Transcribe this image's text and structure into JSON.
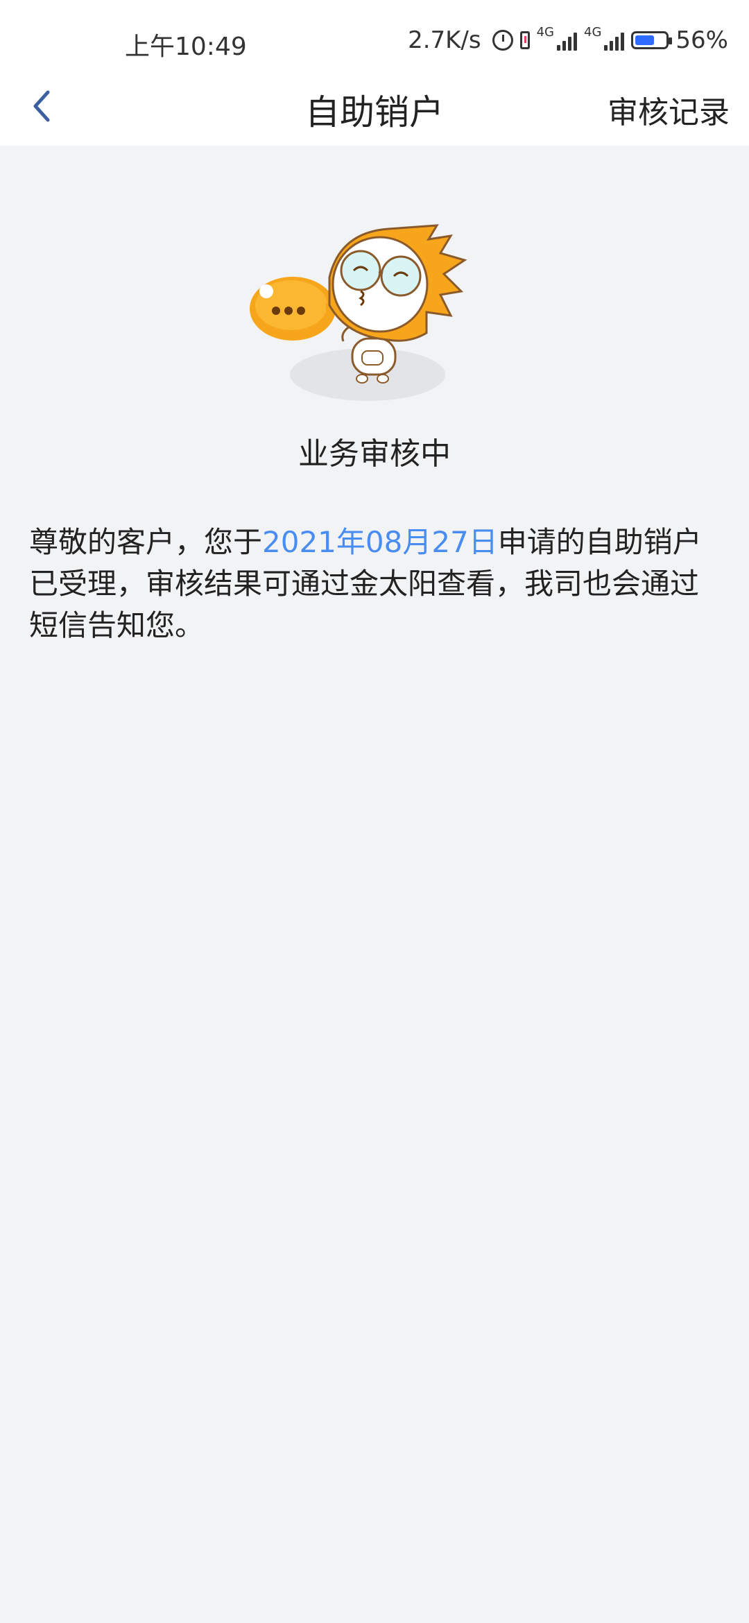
{
  "status_bar": {
    "time": "上午10:49",
    "net_speed": "2.7K/s",
    "net1": "4G",
    "net2": "4G",
    "battery": "56%",
    "icons": [
      "alarm-icon",
      "sim-icon",
      "signal-icon",
      "signal-icon",
      "battery-icon"
    ]
  },
  "header": {
    "back_icon": "chevron-left-icon",
    "title": "自助销户",
    "action": "审核记录"
  },
  "status": {
    "mascot": "sun-mascot-illustration",
    "title": "业务审核中"
  },
  "message": {
    "prefix": "尊敬的客户，您于",
    "date": "2021年08月27日",
    "suffix": "申请的自助销户已受理，审核结果可通过金太阳查看，我司也会通过短信告知您。"
  },
  "colors": {
    "accent": "#4a8df0",
    "background": "#f2f3f5",
    "header_bg": "#ffffff",
    "back_icon": "#3b5fa0"
  }
}
